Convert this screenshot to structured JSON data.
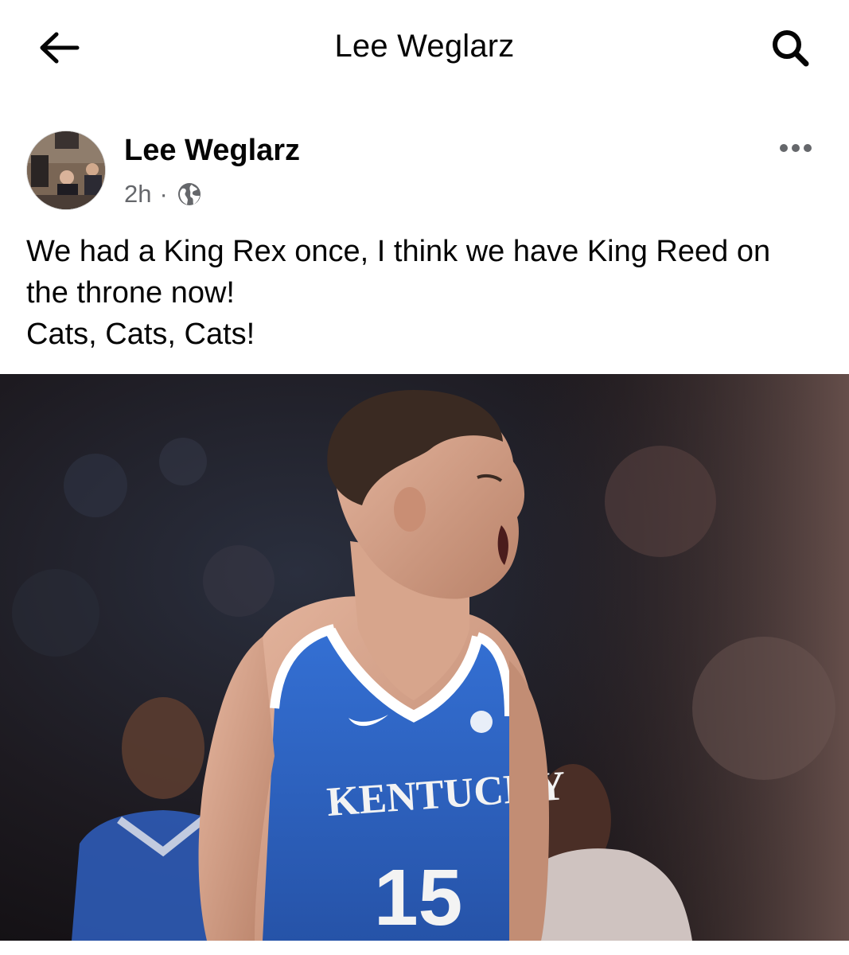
{
  "header": {
    "title": "Lee Weglarz",
    "back_icon": "arrow-left-icon",
    "search_icon": "search-icon"
  },
  "post": {
    "author": "Lee Weglarz",
    "time": "2h",
    "separator": "·",
    "privacy_icon": "globe-icon",
    "more_icon": "more-dots-icon",
    "text_lines": [
      "We had a King Rex once, I think we have King Reed on",
      "the throne now!",
      "Cats, Cats, Cats!"
    ],
    "photo": {
      "jersey_text": "KENTUCKY",
      "jersey_number": "15",
      "jersey_color": "#2f63c5"
    }
  }
}
